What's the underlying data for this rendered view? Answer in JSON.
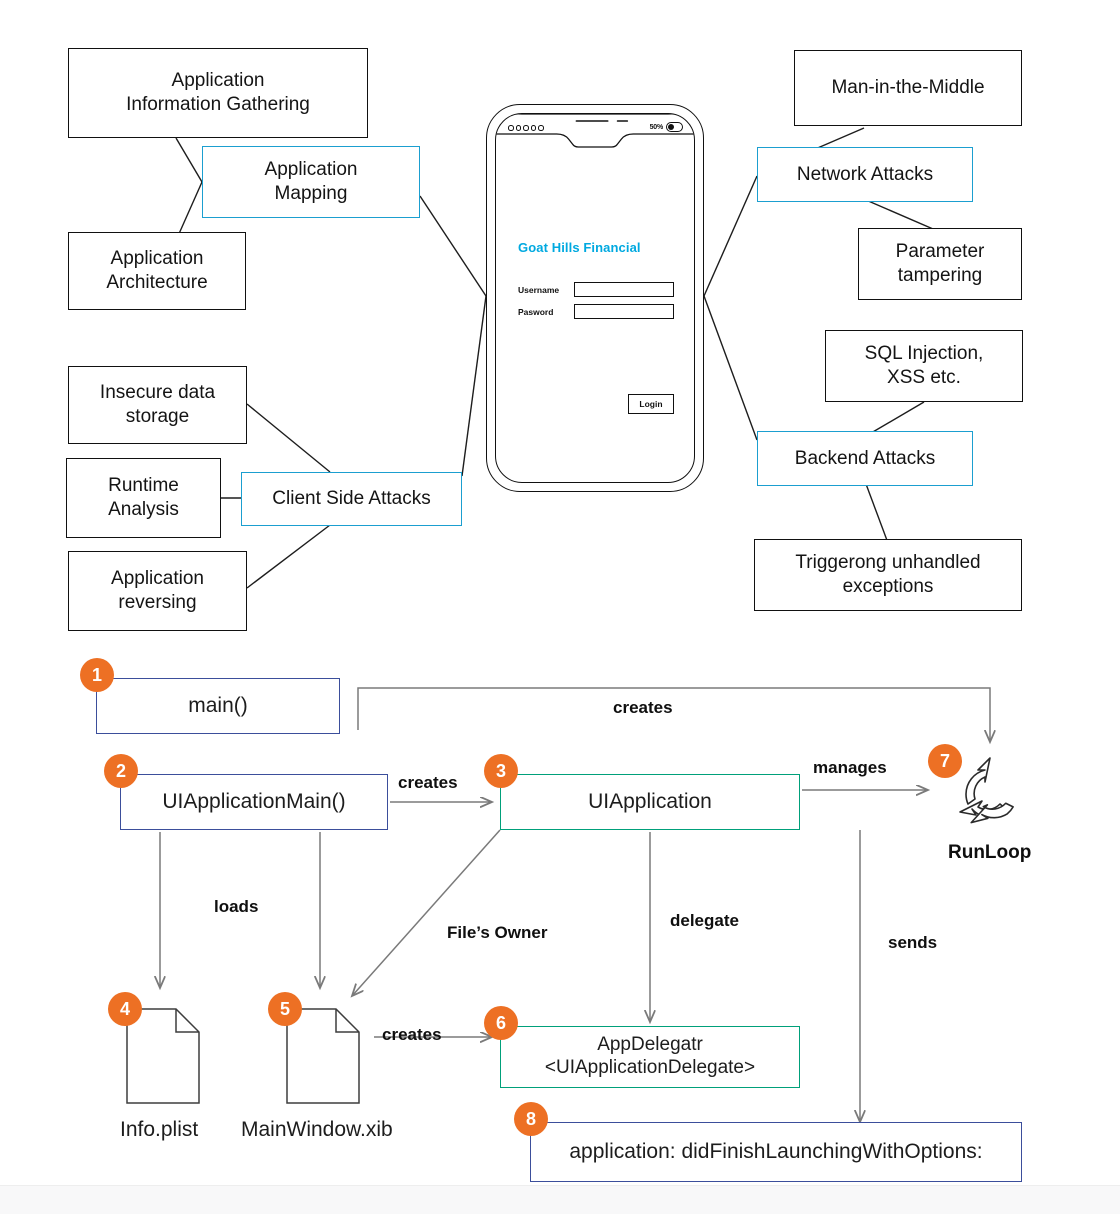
{
  "colors": {
    "accent_cyan": "#1b9fd0",
    "badge_orange": "#ed7024",
    "box_navy": "#3b4e9b",
    "box_teal": "#00a07a",
    "app_brand_cyan": "#00a9e0",
    "line_gray": "#7a7a7a",
    "line_black": "#111111"
  },
  "attack_diagram": {
    "left_group": {
      "hub": {
        "label": "Client Side Attacks",
        "highlighted": true
      },
      "top_hub": {
        "label": "Application\nMapping",
        "highlighted": true
      },
      "boxes": [
        {
          "id": "app-info-gathering",
          "label": "Application\nInformation Gathering"
        },
        {
          "id": "app-architecture",
          "label": "Application\nArchitecture"
        },
        {
          "id": "insecure-data-storage",
          "label": "Insecure data\nstorage"
        },
        {
          "id": "runtime-analysis",
          "label": "Runtime\nAnalysis"
        },
        {
          "id": "application-reversing",
          "label": "Application\nreversing"
        }
      ]
    },
    "right_group": {
      "hubs": [
        {
          "id": "network-attacks",
          "label": "Network Attacks",
          "highlighted": true
        },
        {
          "id": "backend-attacks",
          "label": "Backend Attacks",
          "highlighted": true
        }
      ],
      "boxes": [
        {
          "id": "man-in-the-middle",
          "label": "Man-in-the-Middle"
        },
        {
          "id": "parameter-tampering",
          "label": "Parameter\ntampering"
        },
        {
          "id": "sql-injection-xss",
          "label": "SQL Injection,\nXSS etc."
        },
        {
          "id": "unhandled-exceptions",
          "label": "Triggerong unhandled\nexceptions"
        }
      ]
    },
    "phone": {
      "status_bar": {
        "signal_dots": 5,
        "battery_percent": "50%"
      },
      "app_title": "Goat Hills Financial",
      "fields": [
        {
          "label": "Username",
          "value": "",
          "placeholder": ""
        },
        {
          "label": "Pasword",
          "value": "",
          "placeholder": ""
        }
      ],
      "login_button": "Login"
    }
  },
  "lifecycle_diagram": {
    "nodes": [
      {
        "num": "1",
        "label": "main()",
        "style": "navy"
      },
      {
        "num": "2",
        "label": "UIApplicationMain()",
        "style": "navy"
      },
      {
        "num": "3",
        "label": "UIApplication",
        "style": "teal"
      },
      {
        "num": "4",
        "label": "Info.plist",
        "style": "document"
      },
      {
        "num": "5",
        "label": "MainWindow.xib",
        "style": "document"
      },
      {
        "num": "6",
        "label": "AppDelegatr\n<UIApplicationDelegate>",
        "style": "teal"
      },
      {
        "num": "7",
        "label": "RunLoop",
        "style": "icon"
      },
      {
        "num": "8",
        "label": "application: didFinishLaunchingWithOptions:",
        "style": "navy"
      }
    ],
    "node_labels": {
      "n1": "main()",
      "n2": "UIApplicationMain()",
      "n3": "UIApplication",
      "n4": "Info.plist",
      "n5": "MainWindow.xib",
      "n6_line1": "AppDelegatr",
      "n6_line2": "<UIApplicationDelegate>",
      "n7": "RunLoop",
      "n8": "application: didFinishLaunchingWithOptions:"
    },
    "edge_labels": {
      "creates_top": "creates",
      "creates_main": "creates",
      "creates_delegate": "creates",
      "manages": "manages",
      "loads": "loads",
      "files_owner": "File’s Owner",
      "delegate": "delegate",
      "sends": "sends"
    },
    "badges": [
      "1",
      "2",
      "3",
      "4",
      "5",
      "6",
      "7",
      "8"
    ]
  }
}
